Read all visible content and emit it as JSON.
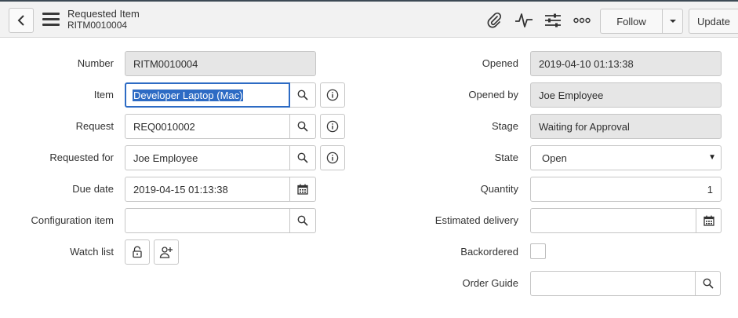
{
  "header": {
    "title": "Requested Item",
    "subtitle": "RITM0010004",
    "follow_label": "Follow",
    "update_label": "Update"
  },
  "icons": [
    "chevron-left-icon",
    "hamburger-menu-icon",
    "paperclip-icon",
    "activity-icon",
    "sliders-icon",
    "more-icon",
    "caret-down-icon",
    "search-icon",
    "info-icon",
    "calendar-icon",
    "lock-icon",
    "add-person-icon"
  ],
  "form": {
    "number": {
      "label": "Number",
      "value": "RITM0010004"
    },
    "item": {
      "label": "Item",
      "value": "Developer Laptop (Mac)"
    },
    "request": {
      "label": "Request",
      "value": "REQ0010002"
    },
    "requested_for": {
      "label": "Requested for",
      "value": "Joe Employee"
    },
    "due_date": {
      "label": "Due date",
      "value": "2019-04-15 01:13:38"
    },
    "configuration_item": {
      "label": "Configuration item",
      "value": ""
    },
    "watch_list": {
      "label": "Watch list"
    },
    "opened": {
      "label": "Opened",
      "value": "2019-04-10 01:13:38"
    },
    "opened_by": {
      "label": "Opened by",
      "value": "Joe Employee"
    },
    "stage": {
      "label": "Stage",
      "value": "Waiting for Approval"
    },
    "state": {
      "label": "State",
      "value": "Open"
    },
    "quantity": {
      "label": "Quantity",
      "value": "1"
    },
    "estimated_delivery": {
      "label": "Estimated delivery",
      "value": ""
    },
    "backordered": {
      "label": "Backordered",
      "checked": false
    },
    "order_guide": {
      "label": "Order Guide",
      "value": ""
    }
  },
  "colors": {
    "accent": "#2d6bc4",
    "readonly_bg": "#e6e6e6",
    "header_bg": "#f2f2f2"
  }
}
